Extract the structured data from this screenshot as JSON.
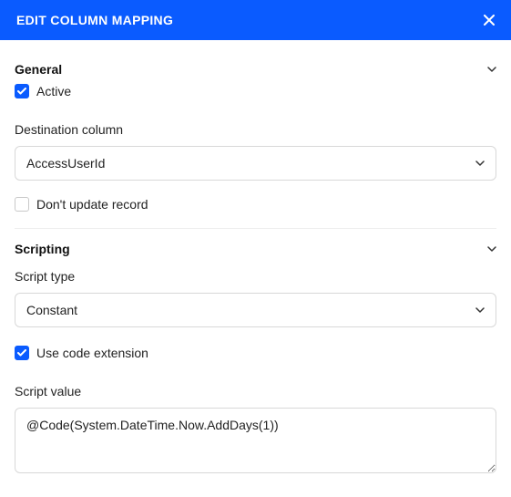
{
  "header": {
    "title": "EDIT COLUMN MAPPING",
    "close_icon": "close-icon"
  },
  "sections": {
    "general": {
      "title": "General",
      "active": {
        "label": "Active",
        "checked": true
      },
      "destination_column": {
        "label": "Destination column",
        "value": "AccessUserId"
      },
      "dont_update": {
        "label": "Don't update record",
        "checked": false
      }
    },
    "scripting": {
      "title": "Scripting",
      "script_type": {
        "label": "Script type",
        "value": "Constant"
      },
      "use_code_extension": {
        "label": "Use code extension",
        "checked": true
      },
      "script_value": {
        "label": "Script value",
        "value": "@Code(System.DateTime.Now.AddDays(1))"
      }
    }
  }
}
